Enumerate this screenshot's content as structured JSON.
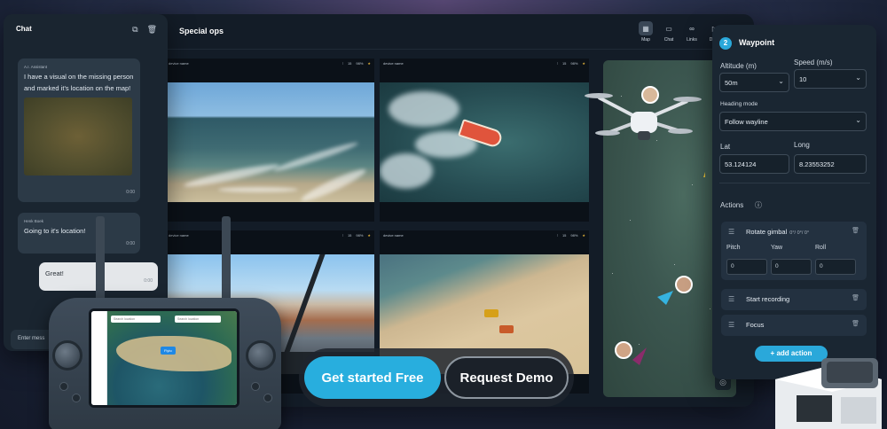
{
  "app": {
    "title": "Special ops",
    "tools": [
      {
        "label": "Map",
        "icon": "map-icon"
      },
      {
        "label": "Chat",
        "icon": "chat-icon"
      },
      {
        "label": "Links",
        "icon": "link-icon"
      },
      {
        "label": "Devic",
        "icon": "device-icon"
      },
      {
        "label": "",
        "icon": "settings-icon"
      }
    ],
    "feeds": [
      {
        "device": "device name",
        "signal": "15",
        "battery": "98%"
      },
      {
        "device": "device name",
        "signal": "15",
        "battery": "98%"
      },
      {
        "device": "device name",
        "signal": "15",
        "battery": "98%"
      },
      {
        "device": "device name",
        "signal": "15",
        "battery": "98%"
      }
    ]
  },
  "chat": {
    "title": "Chat",
    "messages": [
      {
        "author": "A.I. Assistant",
        "text": "I have a visual on the missing person and marked it's location on the map!",
        "time": "0:00"
      },
      {
        "author": "Henk Boek",
        "text": "Going to it's location!",
        "time": "0:00"
      },
      {
        "author": "",
        "text": "Great!",
        "time": "0:00"
      }
    ],
    "input_placeholder": "Enter mess"
  },
  "controller": {
    "search_placeholder": "Search location",
    "flight_label": "Flyto"
  },
  "cta": {
    "primary": "Get started Free",
    "secondary": "Request Demo"
  },
  "waypoint": {
    "number": "2",
    "title": "Waypoint",
    "altitude_label": "Altitude (m)",
    "altitude_value": "50m",
    "speed_label": "Speed (m/s)",
    "speed_value": "10",
    "heading_label": "Heading mode",
    "heading_value": "Follow wayline",
    "lat_label": "Lat",
    "lat_value": "53.124124",
    "long_label": "Long",
    "long_value": "8.23553252",
    "actions_label": "Actions",
    "actions": [
      {
        "name": "Rotate gimbal",
        "extra": "0°/ 0°/ 0°"
      },
      {
        "name": "Start recording",
        "extra": ""
      },
      {
        "name": "Focus",
        "extra": ""
      }
    ],
    "gimbal": {
      "pitch_label": "Pitch",
      "pitch_value": "0",
      "yaw_label": "Yaw",
      "yaw_value": "0",
      "roll_label": "Roll",
      "roll_value": "0"
    },
    "add_action": "add action"
  }
}
